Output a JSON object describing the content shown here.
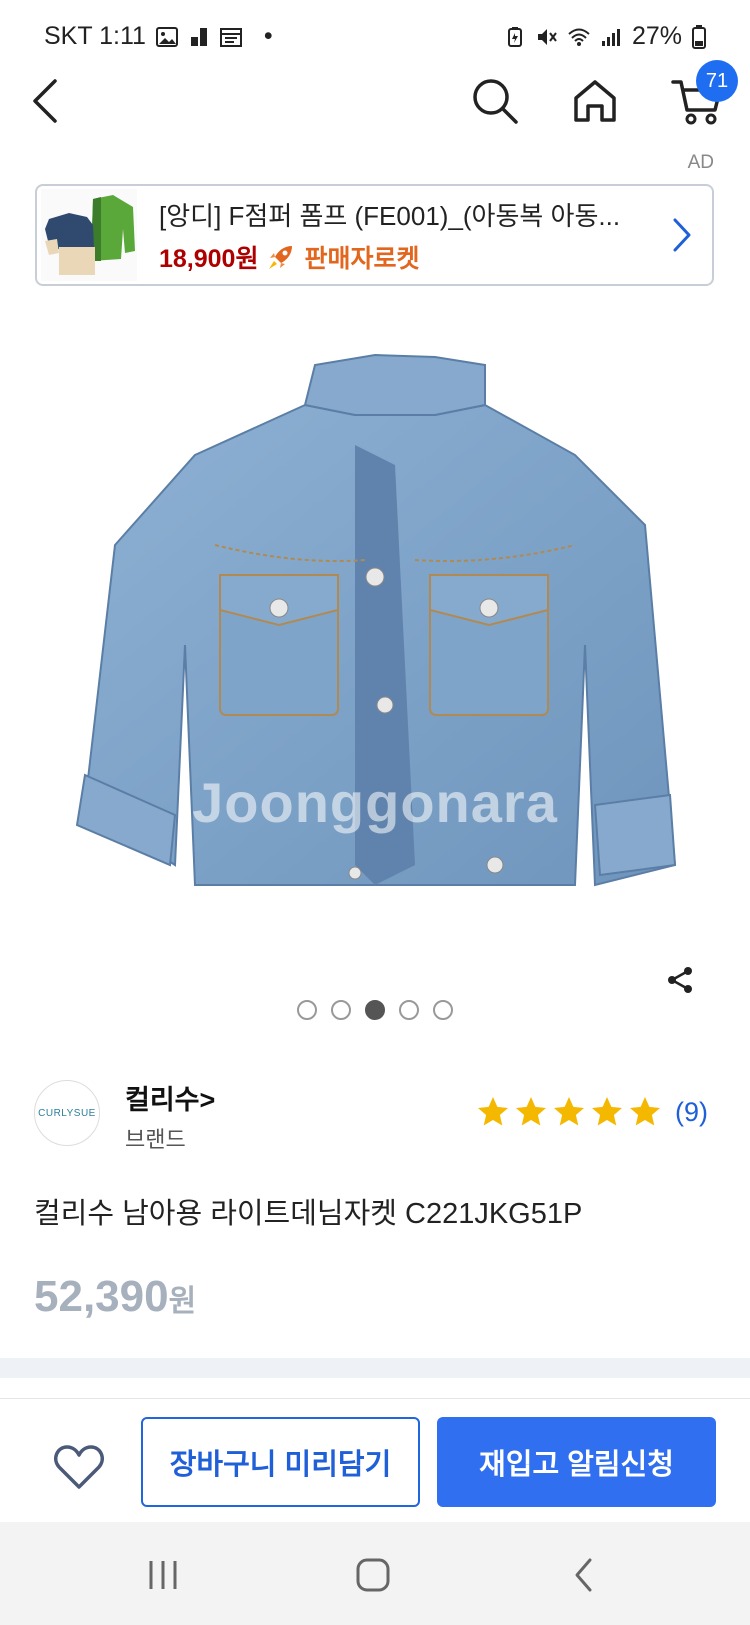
{
  "status_bar": {
    "carrier_time": "SKT 1:11",
    "dot": "•",
    "battery": "27%"
  },
  "nav": {
    "cart_count": "71"
  },
  "ad": {
    "label": "AD",
    "title": "[앙디] F점퍼 폼프 (FE001)_(아동복 아동...",
    "price": "18,900원",
    "badge": "판매자로켓",
    "badge_icon": "rocket-icon"
  },
  "product_image": {
    "watermark": "Joonggonara",
    "total_images": 5,
    "active_index": 3
  },
  "brand": {
    "logo_text": "CURLYSUE",
    "name": "컬리수>",
    "type": "브랜드"
  },
  "rating": {
    "stars": 5,
    "count": "(9)"
  },
  "product": {
    "title": "컬리수 남아용 라이트데님자켓 C221JKG51P",
    "price": "52,390",
    "price_unit": "원"
  },
  "actions": {
    "cart_label": "장바구니 미리담기",
    "notify_label": "재입고 알림신청"
  },
  "colors": {
    "primary": "#2f6ff0",
    "ad_price": "#ae0000",
    "rocket": "#e2661e",
    "star": "#f5b800",
    "muted_price": "#a7b0bd"
  }
}
